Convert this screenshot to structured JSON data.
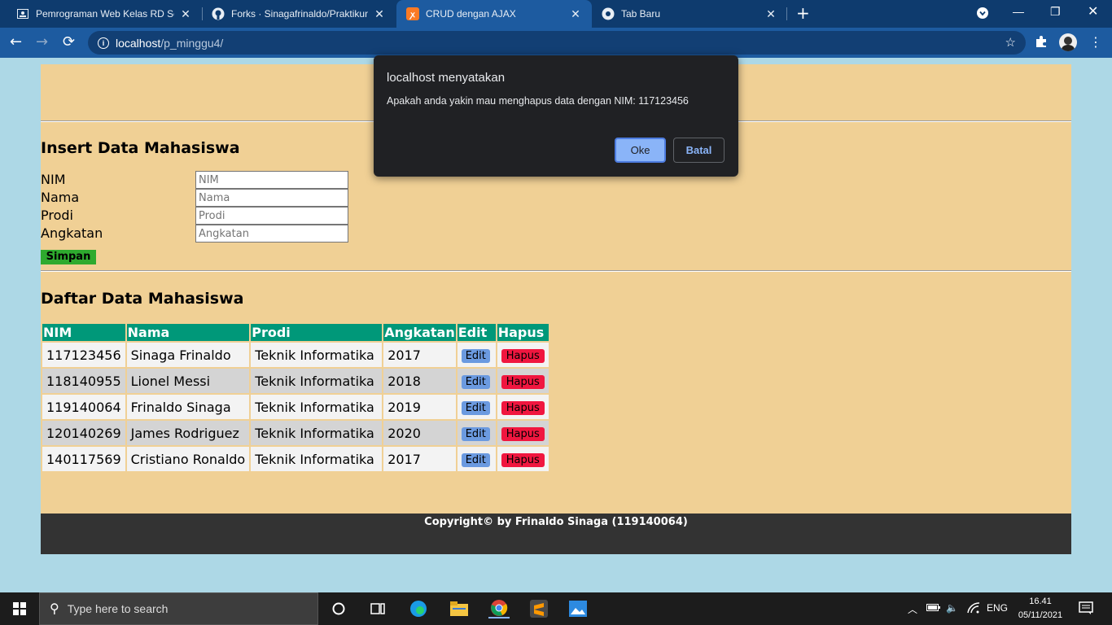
{
  "browser": {
    "tabs": [
      {
        "title": "Pemrograman Web Kelas RD Sem",
        "icon": "classroom-icon"
      },
      {
        "title": "Forks · Sinagafrinaldo/Praktikum",
        "icon": "github-icon"
      },
      {
        "title": "CRUD dengan AJAX",
        "icon": "xampp-icon",
        "active": true
      },
      {
        "title": "Tab Baru",
        "icon": "chrome-icon"
      }
    ],
    "url_host": "localhost",
    "url_path": "/p_minggu4/"
  },
  "page": {
    "insert_title": "Insert Data Mahasiswa",
    "form": {
      "nim_label": "NIM",
      "nama_label": "Nama",
      "prodi_label": "Prodi",
      "angkatan_label": "Angkatan",
      "nim_placeholder": "NIM",
      "nama_placeholder": "Nama",
      "prodi_placeholder": "Prodi",
      "angkatan_placeholder": "Angkatan",
      "submit_label": "Simpan"
    },
    "list_title": "Daftar Data Mahasiswa",
    "table": {
      "headers": [
        "NIM",
        "Nama",
        "Prodi",
        "Angkatan",
        "Edit",
        "Hapus"
      ],
      "edit_label": "Edit",
      "hapus_label": "Hapus",
      "rows": [
        {
          "nim": "117123456",
          "nama": "Sinaga Frinaldo",
          "prodi": "Teknik Informatika",
          "angkatan": "2017"
        },
        {
          "nim": "118140955",
          "nama": "Lionel Messi",
          "prodi": "Teknik Informatika",
          "angkatan": "2018"
        },
        {
          "nim": "119140064",
          "nama": "Frinaldo Sinaga",
          "prodi": "Teknik Informatika",
          "angkatan": "2019"
        },
        {
          "nim": "120140269",
          "nama": "James Rodriguez",
          "prodi": "Teknik Informatika",
          "angkatan": "2020"
        },
        {
          "nim": "140117569",
          "nama": "Cristiano Ronaldo",
          "prodi": "Teknik Informatika",
          "angkatan": "2017"
        }
      ]
    },
    "footer": "Copyright© by Frinaldo Sinaga (119140064)"
  },
  "dialog": {
    "title": "localhost menyatakan",
    "message": "Apakah anda yakin mau menghapus data dengan NIM: 117123456",
    "ok_label": "Oke",
    "cancel_label": "Batal"
  },
  "taskbar": {
    "search_placeholder": "Type here to search",
    "language": "ENG",
    "time": "16.41",
    "date": "05/11/2021"
  },
  "colors": {
    "page_bg": "#add8e6",
    "content_bg": "#f0d095",
    "table_header": "#009879",
    "edit_button": "#6b9ae0",
    "hapus_button": "#f0163f",
    "simpan_button": "#2eaa2e"
  }
}
